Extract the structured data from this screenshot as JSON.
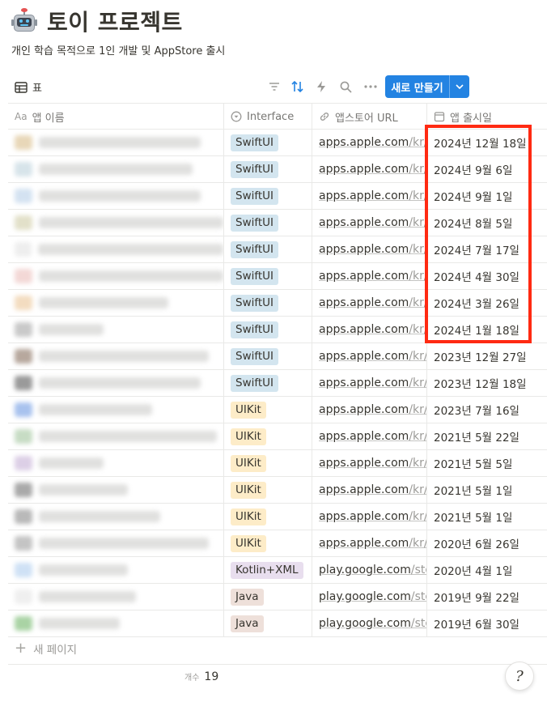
{
  "page": {
    "title": "토이 프로젝트",
    "icon": "robot-icon",
    "subtitle": "개인 학습 목적으로 1인 개발 및 AppStore 출시"
  },
  "toolbar": {
    "view_label": "표",
    "view_icon": "table-icon",
    "tools": [
      "filter-icon",
      "sort-icon",
      "automation-icon",
      "search-icon",
      "more-icon"
    ],
    "new_button_label": "새로 만들기",
    "accent": "#2383e2"
  },
  "columns": [
    {
      "label": "앱 이름",
      "icon": "Aa"
    },
    {
      "label": "Interface",
      "icon": "select-icon"
    },
    {
      "label": "앱스토어 URL",
      "icon": "link-icon"
    },
    {
      "label": "앱 출시일",
      "icon": "calendar-icon"
    }
  ],
  "rows": [
    {
      "interface": "SwiftUI",
      "url_host": "apps.apple.com",
      "url_tail": "/kr/...",
      "date": "2024년 12월 18일",
      "icon_color": "#e8d7b8",
      "name_width": 200
    },
    {
      "interface": "SwiftUI",
      "url_host": "apps.apple.com",
      "url_tail": "/kr/...",
      "date": "2024년 9월 6일",
      "icon_color": "#d7e4ea",
      "name_width": 190
    },
    {
      "interface": "SwiftUI",
      "url_host": "apps.apple.com",
      "url_tail": "/kr/...",
      "date": "2024년 9월 1일",
      "icon_color": "#d4e2f1",
      "name_width": 200
    },
    {
      "interface": "SwiftUI",
      "url_host": "apps.apple.com",
      "url_tail": "/kr/...",
      "date": "2024년 8월 5일",
      "icon_color": "#e2e0c9",
      "name_width": 230
    },
    {
      "interface": "SwiftUI",
      "url_host": "apps.apple.com",
      "url_tail": "/kr/...",
      "date": "2024년 7월 17일",
      "icon_color": "#eeeeee",
      "name_width": 240
    },
    {
      "interface": "SwiftUI",
      "url_host": "apps.apple.com",
      "url_tail": "/kr/...",
      "date": "2024년 4월 30일",
      "icon_color": "#f3d8d6",
      "name_width": 230
    },
    {
      "interface": "SwiftUI",
      "url_host": "apps.apple.com",
      "url_tail": "/kr/...",
      "date": "2024년 3월 26일",
      "icon_color": "#f3dcc0",
      "name_width": 160
    },
    {
      "interface": "SwiftUI",
      "url_host": "apps.apple.com",
      "url_tail": "/kr/...",
      "date": "2024년 1월 18일",
      "icon_color": "#c9c9c9",
      "name_width": 80
    },
    {
      "interface": "SwiftUI",
      "url_host": "apps.apple.com",
      "url_tail": "/kr/...",
      "date": "2023년 12월 27일",
      "icon_color": "#b7a89d",
      "name_width": 210
    },
    {
      "interface": "SwiftUI",
      "url_host": "apps.apple.com",
      "url_tail": "/kr/...",
      "date": "2023년 12월 18일",
      "icon_color": "#9a9a9a",
      "name_width": 200
    },
    {
      "interface": "UIKit",
      "url_host": "apps.apple.com",
      "url_tail": "/kr/...",
      "date": "2023년 7월 16일",
      "icon_color": "#a8c2ee",
      "name_width": 140
    },
    {
      "interface": "UIKit",
      "url_host": "apps.apple.com",
      "url_tail": "/kr/...",
      "date": "2021년 5월 22일",
      "icon_color": "#c7dcc4",
      "name_width": 220
    },
    {
      "interface": "UIKit",
      "url_host": "apps.apple.com",
      "url_tail": "/kr/...",
      "date": "2021년 5월 5일",
      "icon_color": "#dccfe6",
      "name_width": 80
    },
    {
      "interface": "UIKit",
      "url_host": "apps.apple.com",
      "url_tail": "/kr/...",
      "date": "2021년 5월 1일",
      "icon_color": "#a9a9a9",
      "name_width": 110
    },
    {
      "interface": "UIKit",
      "url_host": "apps.apple.com",
      "url_tail": "/kr/...",
      "date": "2021년 5월 1일",
      "icon_color": "#b9b9b9",
      "name_width": 150
    },
    {
      "interface": "UIKit",
      "url_host": "apps.apple.com",
      "url_tail": "/kr/...",
      "date": "2020년 6월 26일",
      "icon_color": "#c4c4c4",
      "name_width": 210
    },
    {
      "interface": "Kotlin+XML",
      "url_host": "play.google.com",
      "url_tail": "/sto...",
      "date": "2020년 4월 1일",
      "icon_color": "#cfe1f5",
      "name_width": 110
    },
    {
      "interface": "Java",
      "url_host": "play.google.com",
      "url_tail": "/sto...",
      "date": "2019년 9월 22일",
      "icon_color": "#efefef",
      "name_width": 120
    },
    {
      "interface": "Java",
      "url_host": "play.google.com",
      "url_tail": "/sto...",
      "date": "2019년 6월 30일",
      "icon_color": "#a9d3a4",
      "name_width": 100
    }
  ],
  "tag_colors": {
    "SwiftUI": "#d3e5ef",
    "UIKit": "#fdecc8",
    "Kotlin+XML": "#e8deee",
    "Java": "#eee0da"
  },
  "footer": {
    "new_page_label": "새 페이지",
    "count_label": "개수",
    "count_value": "19"
  },
  "highlight_color": "#ff2a12"
}
